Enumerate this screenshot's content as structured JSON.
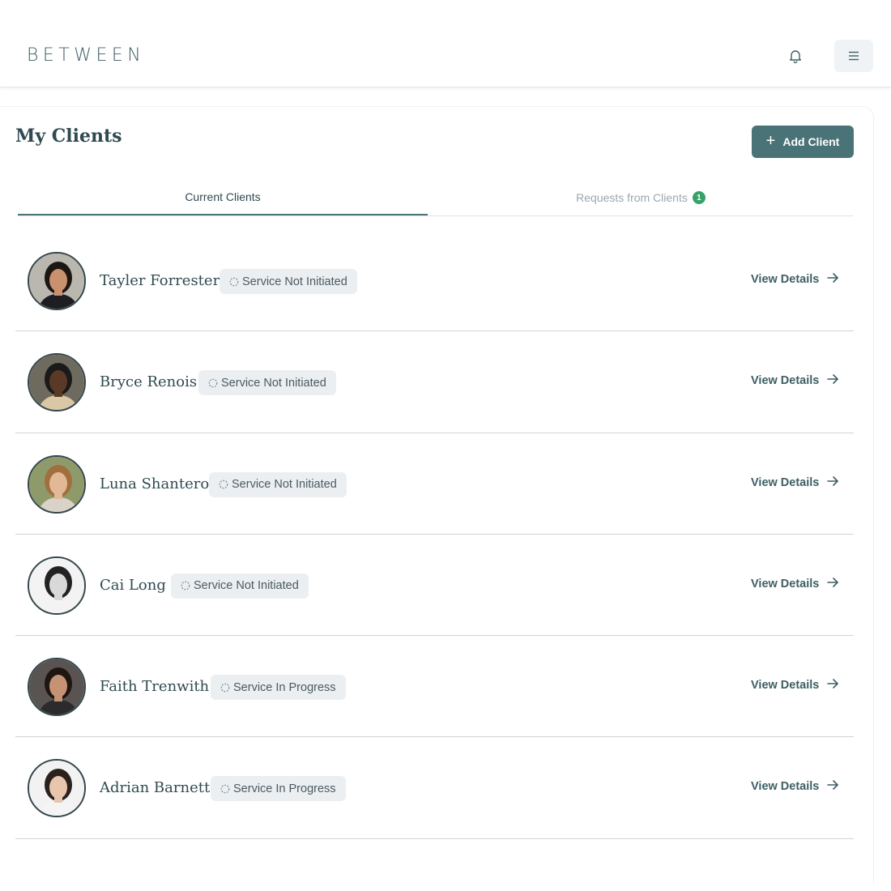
{
  "app": {
    "logo": "BETWEEN"
  },
  "header": {
    "notification_icon": "bell-icon",
    "menu_icon": "hamburger-menu-icon"
  },
  "page": {
    "title": "My Clients",
    "add_client_label": "Add Client"
  },
  "tabs": {
    "current": "Current Clients",
    "requests": "Requests from Clients",
    "requests_count": "1"
  },
  "clients": [
    {
      "name": "Tayler Forrester",
      "status": "Service Not Initiated",
      "action": "View Details"
    },
    {
      "name": "Bryce Renois",
      "status": "Service Not Initiated",
      "action": "View Details"
    },
    {
      "name": "Luna Shantero",
      "status": "Service Not Initiated",
      "action": "View Details"
    },
    {
      "name": "Cai Long",
      "status": "Service Not Initiated",
      "action": "View Details"
    },
    {
      "name": "Faith Trenwith",
      "status": "Service In Progress",
      "action": "View Details"
    },
    {
      "name": "Adrian Barnett",
      "status": "Service In Progress",
      "action": "View Details"
    }
  ],
  "colors": {
    "brand": "#4a7378",
    "badge": "#38a169",
    "text": "#2f4a50"
  }
}
